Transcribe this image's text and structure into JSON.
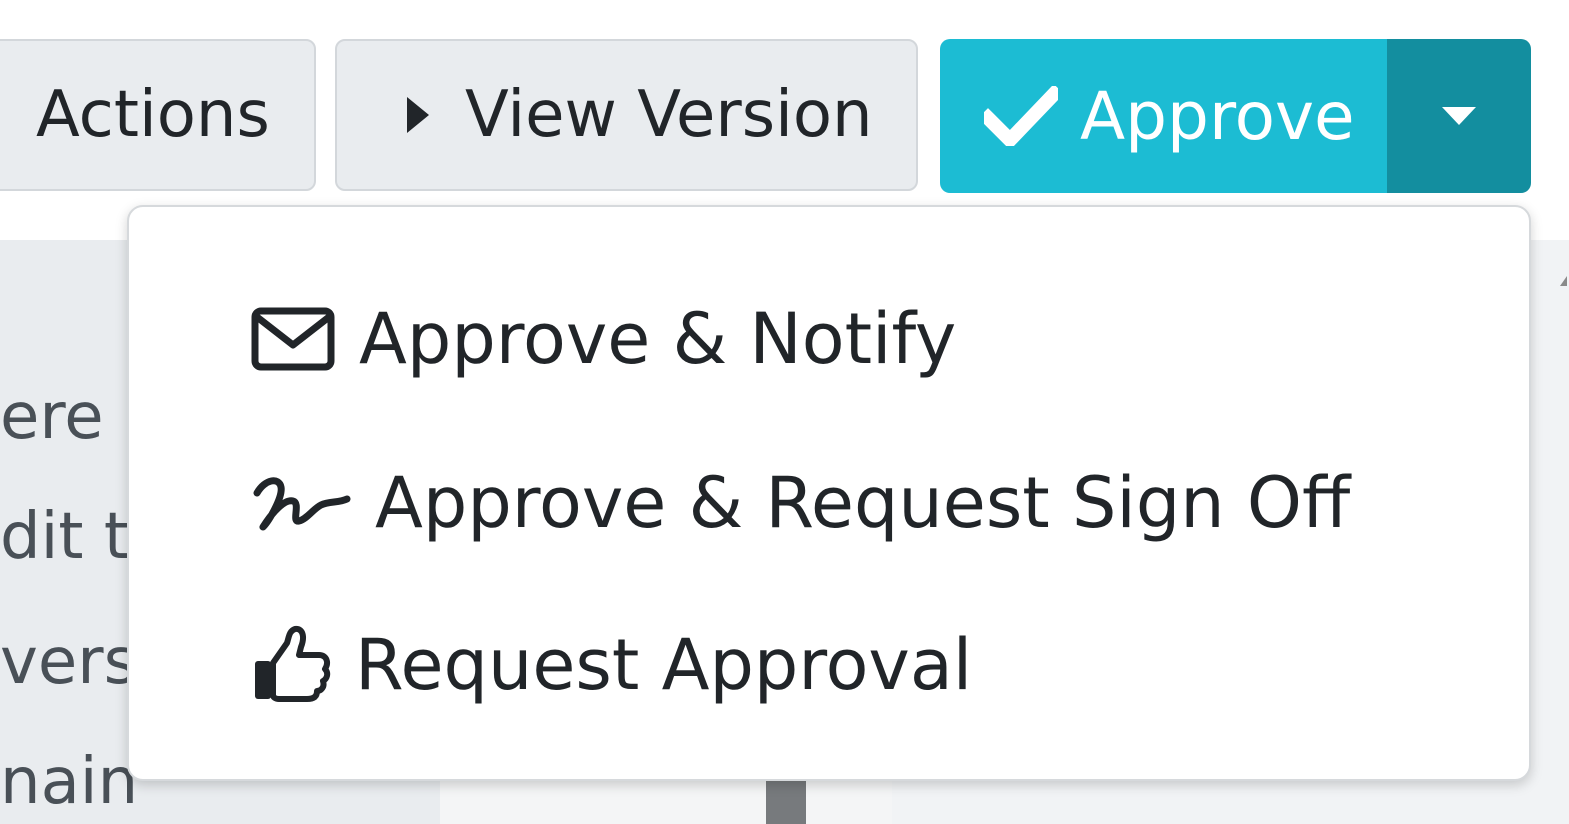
{
  "toolbar": {
    "actions_label": "Actions",
    "view_version_label": "View Version",
    "approve_label": "Approve"
  },
  "approve_menu": {
    "items": [
      {
        "label": "Approve & Notify",
        "icon": "envelope-icon"
      },
      {
        "label": "Approve & Request Sign Off",
        "icon": "signature-icon"
      },
      {
        "label": "Request Approval",
        "icon": "thumbs-up-icon"
      }
    ]
  },
  "background_text": {
    "line1": "ere",
    "line2": "dit t",
    "line3": " vers",
    "line4": "nain"
  },
  "colors": {
    "approve_primary": "#1cbcd3",
    "approve_toggle": "#138e9f",
    "secondary_button": "#e9ecef"
  }
}
